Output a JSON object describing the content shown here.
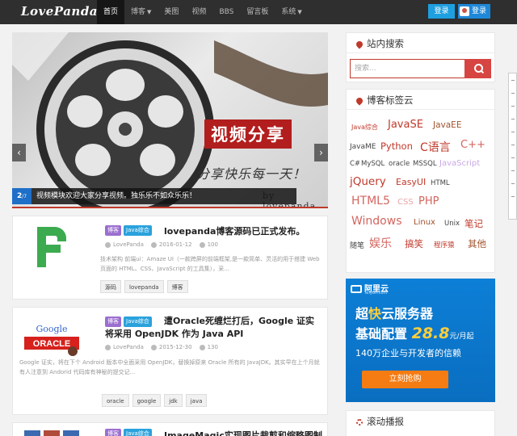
{
  "header": {
    "logo": "LovePanda",
    "nav": [
      {
        "label": "首页",
        "active": true
      },
      {
        "label": "博客",
        "dropdown": true
      },
      {
        "label": "美图"
      },
      {
        "label": "视频"
      },
      {
        "label": "BBS"
      },
      {
        "label": "留言板"
      },
      {
        "label": "系统",
        "dropdown": true
      }
    ],
    "login_label": "登录",
    "register_label": "登录"
  },
  "slider": {
    "title": "视频分享",
    "subtitle": "分享快乐每一天！",
    "author": "by lovepanda",
    "counter_current": "2",
    "counter_total": "/7",
    "caption": "视频模块欢迎大家分享视频。独乐乐不如众乐乐！",
    "prev_icon": "chevron-left-icon",
    "next_icon": "chevron-right-icon"
  },
  "posts": [
    {
      "badges": [
        "博客",
        "Java综合"
      ],
      "title": "lovepanda博客源码已正式发布。",
      "author": "LovePanda",
      "date": "2016-01-12",
      "views": "100",
      "excerpt": "技术架构 前端ui：Amaze UI（一款跨屏的前端框架,是一款简单、灵活的用于搭建 Web 页面的 HTML、CSS、JavaScript 的工具集），采...",
      "keywords": [
        "源码",
        "lovepanda",
        "博客"
      ]
    },
    {
      "badges": [
        "博客",
        "Java综合"
      ],
      "title": "遭Oracle死缠烂打后，Google 证实将采用 OpenJDK 作为 Java API",
      "author": "LovePanda",
      "date": "2015-12-30",
      "views": "130",
      "excerpt": "Google 证实，将在下个 Android 版本中全面采用 OpenJDK，替换掉原来 Oracle 所有的 JavaJDK。其实早在上个月就有人注意到 Andorid 代码库有神秘的提交记...",
      "keywords": [
        "oracle",
        "google",
        "jdk",
        "java"
      ]
    },
    {
      "badges": [
        "博客",
        "Java综合"
      ],
      "title": "ImageMagic实现图片裁剪和缩略图制"
    }
  ],
  "sidebar": {
    "search_title": "站内搜索",
    "search_placeholder": "搜索...",
    "tags_title": "博客标签云",
    "tags": [
      {
        "text": "Java综合",
        "color": "#c0392b"
      },
      {
        "text": "JavaSE",
        "color": "#c0392b"
      },
      {
        "text": "JavaEE",
        "color": "#a0522d"
      },
      {
        "text": "JavaME",
        "color": "#444444"
      },
      {
        "text": "Python",
        "color": "#c0392b"
      },
      {
        "text": "C语言",
        "color": "#c0392b"
      },
      {
        "text": "C++",
        "color": "#d4655f"
      },
      {
        "text": "C#",
        "color": "#444444"
      },
      {
        "text": "MySQL",
        "color": "#444444"
      },
      {
        "text": "oracle",
        "color": "#444444"
      },
      {
        "text": "MSSQL",
        "color": "#444444"
      },
      {
        "text": "JavaScript",
        "color": "#c9a8e6"
      },
      {
        "text": "jQuery",
        "color": "#c0392b"
      },
      {
        "text": "EasyUI",
        "color": "#c0392b"
      },
      {
        "text": "HTML",
        "color": "#444444"
      },
      {
        "text": "HTML5",
        "color": "#d4655f"
      },
      {
        "text": "CSS",
        "color": "#e8a5a5"
      },
      {
        "text": "PHP",
        "color": "#d4655f"
      },
      {
        "text": "Windows",
        "color": "#d4655f"
      },
      {
        "text": "Linux",
        "color": "#a0522d"
      },
      {
        "text": "Unix",
        "color": "#444444"
      },
      {
        "text": "笔记",
        "color": "#c0392b"
      },
      {
        "text": "随笔",
        "color": "#444444"
      },
      {
        "text": "娱乐",
        "color": "#d4655f"
      },
      {
        "text": "搞笑",
        "color": "#c0392b"
      },
      {
        "text": "程序猿",
        "color": "#c0392b"
      },
      {
        "text": "其他",
        "color": "#a0522d"
      }
    ],
    "ad": {
      "logo": "阿里云",
      "logo_url": "aliyun.com",
      "line1_prefix": "超",
      "line1_highlight": "快",
      "line1_suffix": "云服务器",
      "line2_prefix": "基础配置",
      "price": "28.8",
      "unit": "元/月起",
      "line3": "140万企业与开发者的信赖",
      "cta": "立刻抢购"
    },
    "scroll_title": "滚动播报"
  },
  "colors": {
    "accent": "#c0392b",
    "nav_bg": "#2f2f2f",
    "primary_blue": "#1e9fe0"
  }
}
